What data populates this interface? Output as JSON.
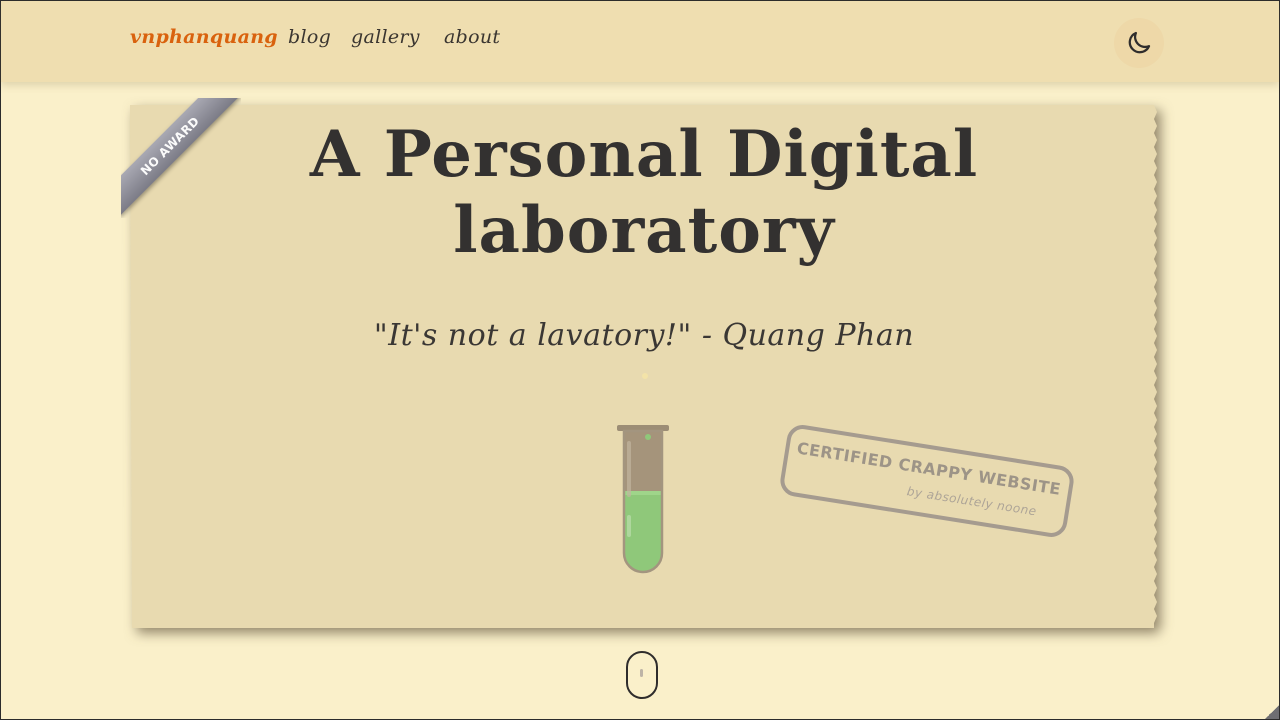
{
  "nav": {
    "brand": "vnphanquang",
    "links": [
      {
        "label": "blog"
      },
      {
        "label": "gallery"
      },
      {
        "label": "about"
      }
    ],
    "theme_toggle_icon": "moon-icon"
  },
  "hero": {
    "ribbon": "NO AWARD",
    "title_line1": "A Personal Digital",
    "title_line2": "laboratory",
    "quote": "\"It's not a lavatory!\" - Quang Phan",
    "illustration_icon": "test-tube-icon",
    "stamp": {
      "line1": "CERTIFIED CRAPPY WEBSITE",
      "line2": "by absolutely noone"
    }
  },
  "scroll_indicator_icon": "mouse-scroll-icon",
  "colors": {
    "page_bg": "#faf0ca",
    "nav_bg": "#efdeb0",
    "card_bg": "#e8dab0",
    "brand": "#d9620e",
    "text": "#333130",
    "liquid": "#8fc87a"
  }
}
